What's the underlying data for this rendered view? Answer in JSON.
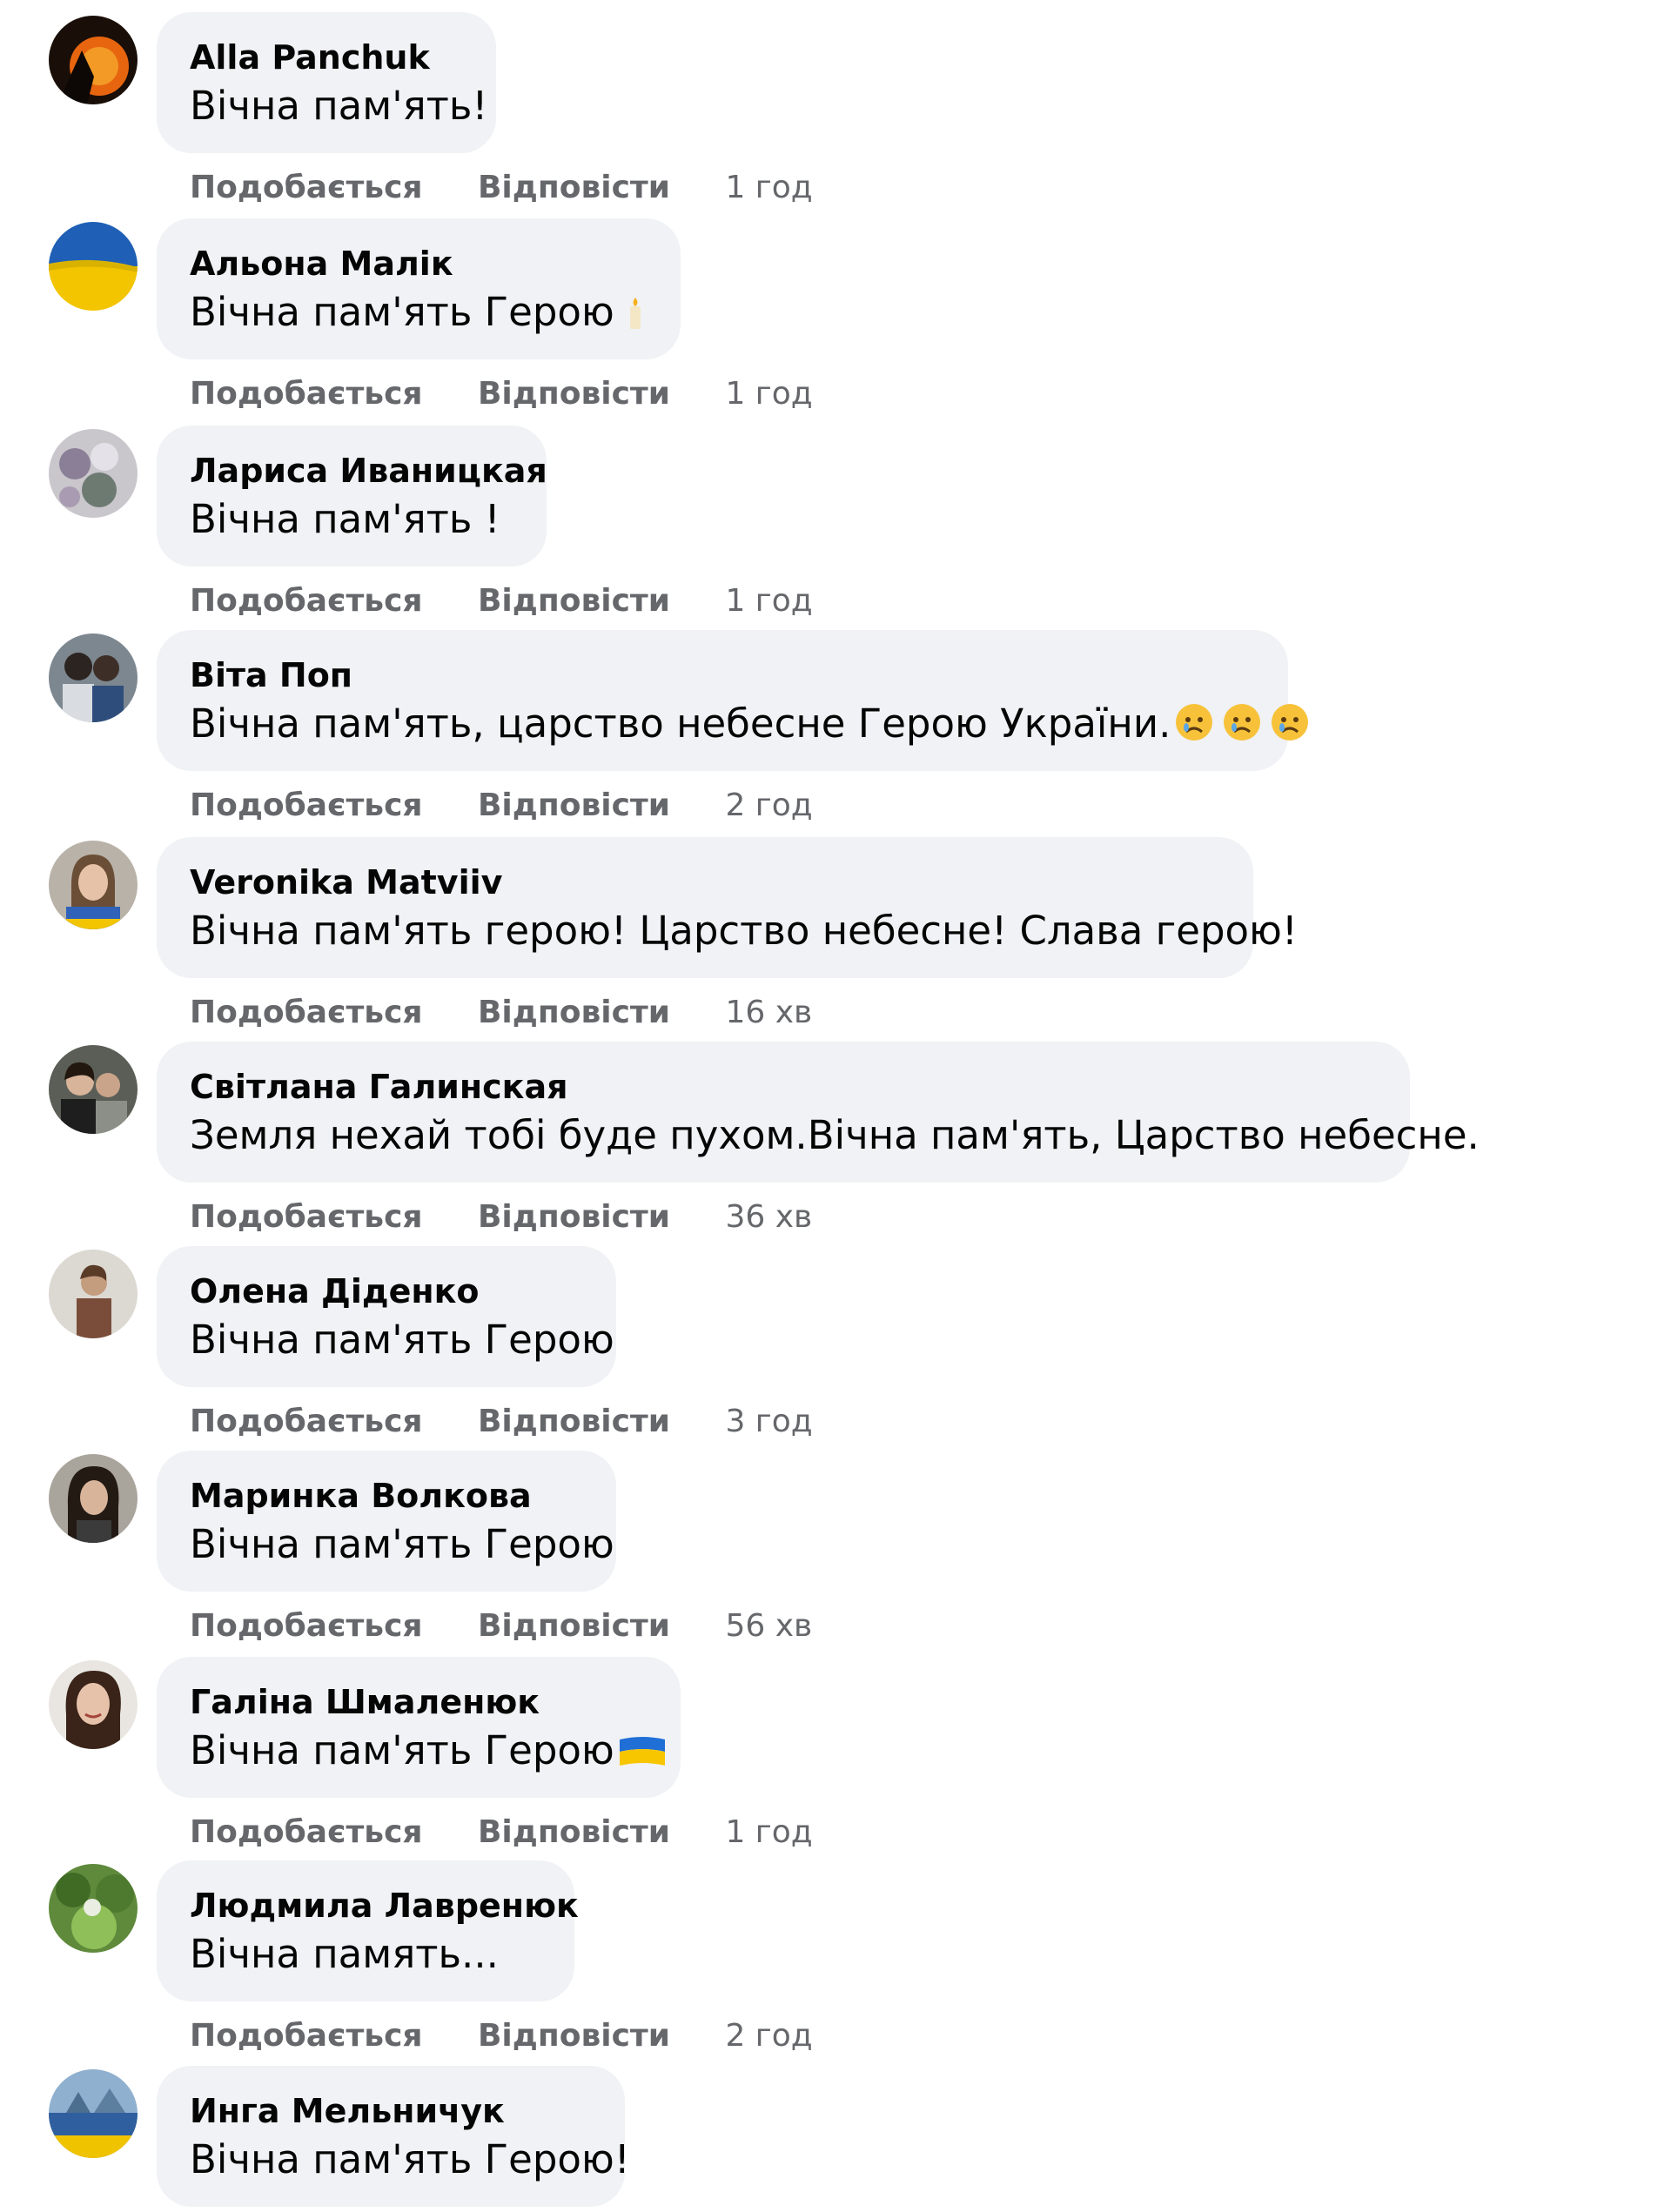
{
  "actions": {
    "like_label": "Подобається",
    "reply_label": "Відповісти"
  },
  "comments": [
    {
      "author": "Alla Panchuk",
      "text": "Вічна пам'ять!",
      "time": "1 год",
      "avatar_icon": "sunset-avatar-icon"
    },
    {
      "author": "Альона Малік",
      "text": "Вічна пам'ять Герою",
      "time": "1 год",
      "emoji": "candle-icon",
      "avatar_icon": "ukraine-flag-avatar-icon"
    },
    {
      "author": "Лариса Иваницкая",
      "text": "Вічна пам'ять !",
      "time": "1 год",
      "avatar_icon": "flowers-avatar-icon"
    },
    {
      "author": "Віта Поп",
      "text": "Вічна пам'ять, царство небесне Герою України.",
      "time": "2 год",
      "emoji": "sad-face-icons",
      "avatar_icon": "two-people-avatar-icon"
    },
    {
      "author": "Veronika Matviiv",
      "text": "Вічна пам'ять герою! Царство небесне! Слава герою!",
      "time": "16 хв",
      "avatar_icon": "woman-avatar-icon"
    },
    {
      "author": "Світлана Галинская",
      "text": "Земля нехай тобі буде пухом.Вічна пам'ять, Царство небесне.",
      "time": "36 хв",
      "avatar_icon": "couple-avatar-icon"
    },
    {
      "author": "Олена Діденко",
      "text": "Вічна пам'ять Герою",
      "time": "3 год",
      "avatar_icon": "person-avatar-icon"
    },
    {
      "author": "Маринка Волкова",
      "text": "Вічна пам'ять Герою",
      "time": "56 хв",
      "avatar_icon": "dark-hair-avatar-icon"
    },
    {
      "author": "Галіна Шмаленюк",
      "text": "Вічна пам'ять Герою",
      "time": "1 год",
      "emoji": "ukraine-flag-icon",
      "avatar_icon": "woman-portrait-avatar-icon"
    },
    {
      "author": "Людмила Лавренюк",
      "text": "Вічна память...",
      "time": "2 год",
      "avatar_icon": "garden-avatar-icon"
    },
    {
      "author": "Инга Мельничук",
      "text": "Вічна пам'ять Герою!",
      "avatar_icon": "flag-landscape-avatar-icon"
    }
  ],
  "colors": {
    "bubble_bg": "#f0f2f5",
    "action_text": "#65676b",
    "body_text": "#050505"
  }
}
